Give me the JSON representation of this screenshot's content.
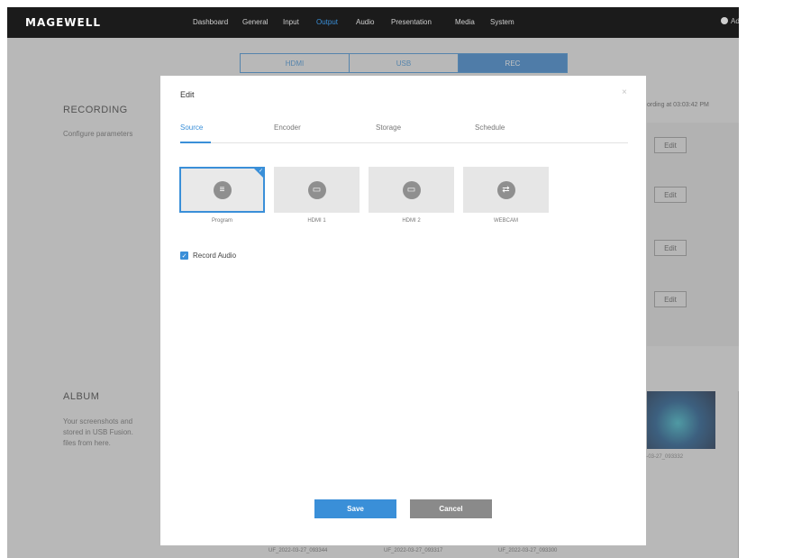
{
  "nav": {
    "logo": "MAGEWELL",
    "items": [
      "Dashboard",
      "General",
      "Input",
      "Output",
      "Audio",
      "Presentation",
      "Media",
      "System"
    ],
    "active": "Output",
    "user": "Admin ⌄"
  },
  "output_tabs": [
    "HDMI",
    "USB",
    "REC"
  ],
  "output_tab_active": "REC",
  "recording": {
    "title": "RECORDING",
    "desc": "Configure parameters",
    "status_time": "ording at 03:03:42 PM",
    "edit_label": "Edit"
  },
  "album": {
    "title": "ALBUM",
    "desc1": "Your screenshots and",
    "desc2": "stored in USB Fusion.",
    "desc3": "files from here.",
    "thumb_caption": "2-03-27_093332",
    "file_captions": [
      "UF_2022-03-27_093344",
      "UF_2022-03-27_093317",
      "UF_2022-03-27_093300"
    ]
  },
  "modal": {
    "title": "Edit",
    "close_glyph": "×",
    "tabs": [
      "Source",
      "Encoder",
      "Storage",
      "Schedule"
    ],
    "active_tab": "Source",
    "sources": [
      {
        "label": "Program",
        "icon": "program-icon",
        "glyph": "≡"
      },
      {
        "label": "HDMI 1",
        "icon": "hdmi-icon",
        "glyph": "▭"
      },
      {
        "label": "HDMI 2",
        "icon": "hdmi-icon",
        "glyph": "▭"
      },
      {
        "label": "WEBCAM",
        "icon": "usb-icon",
        "glyph": "⇄"
      }
    ],
    "selected_source": "Program",
    "record_audio_label": "Record Audio",
    "record_audio_checked": true,
    "save_label": "Save",
    "cancel_label": "Cancel"
  },
  "colors": {
    "accent": "#3a8fd8",
    "topbar": "#1b1b1b",
    "cancel": "#8a8a8a"
  }
}
